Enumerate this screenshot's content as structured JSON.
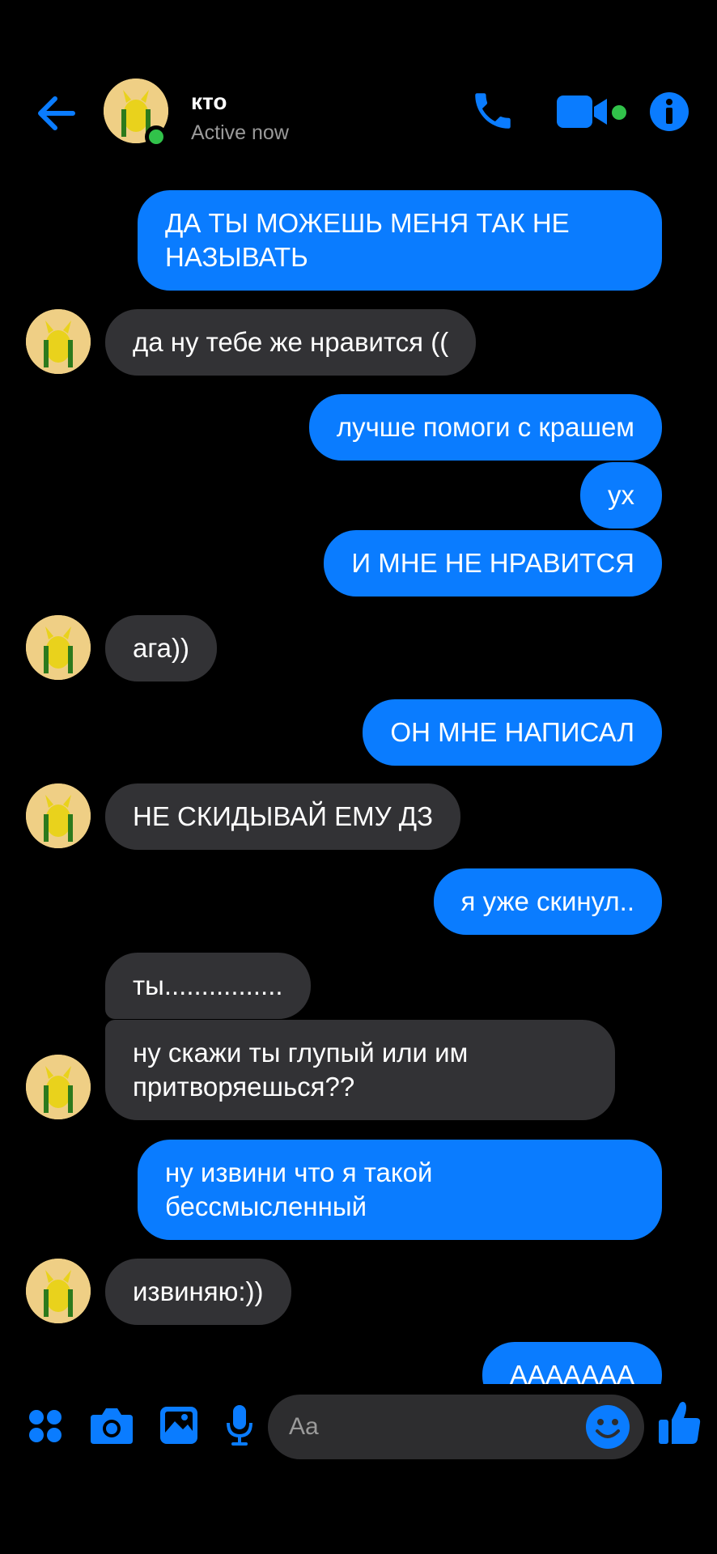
{
  "header": {
    "contact_name": "кто",
    "status": "Active now"
  },
  "messages": [
    {
      "side": "out",
      "text": "ДА ТЫ МОЖЕШЬ МЕНЯ ТАК НЕ\nНАЗЫВАТЬ"
    },
    {
      "side": "in",
      "text": "да ну тебе же нравится (("
    },
    {
      "side": "out",
      "text": "лучше помоги с крашем"
    },
    {
      "side": "out",
      "text": "ух"
    },
    {
      "side": "out",
      "text": "И МНЕ НЕ НРАВИТСЯ"
    },
    {
      "side": "in",
      "text": "ага))"
    },
    {
      "side": "out",
      "text": "ОН МНЕ НАПИСАЛ"
    },
    {
      "side": "in",
      "text": "НЕ СКИДЫВАЙ ЕМУ ДЗ"
    },
    {
      "side": "out",
      "text": "я уже скинул.."
    },
    {
      "side": "in",
      "text": "ты................"
    },
    {
      "side": "in",
      "text": "ну скажи ты глупый или им\nпритворяешься??"
    },
    {
      "side": "out",
      "text": "ну извини что я такой\nбессмысленный"
    },
    {
      "side": "in",
      "text": "извиняю:))"
    },
    {
      "side": "out",
      "text": "АААААAA"
    }
  ],
  "composer": {
    "placeholder": "Aa"
  },
  "colors": {
    "outgoing_bubble": "#0a7cff",
    "incoming_bubble": "#323235",
    "accent": "#0a7cff",
    "online": "#31c24a"
  }
}
